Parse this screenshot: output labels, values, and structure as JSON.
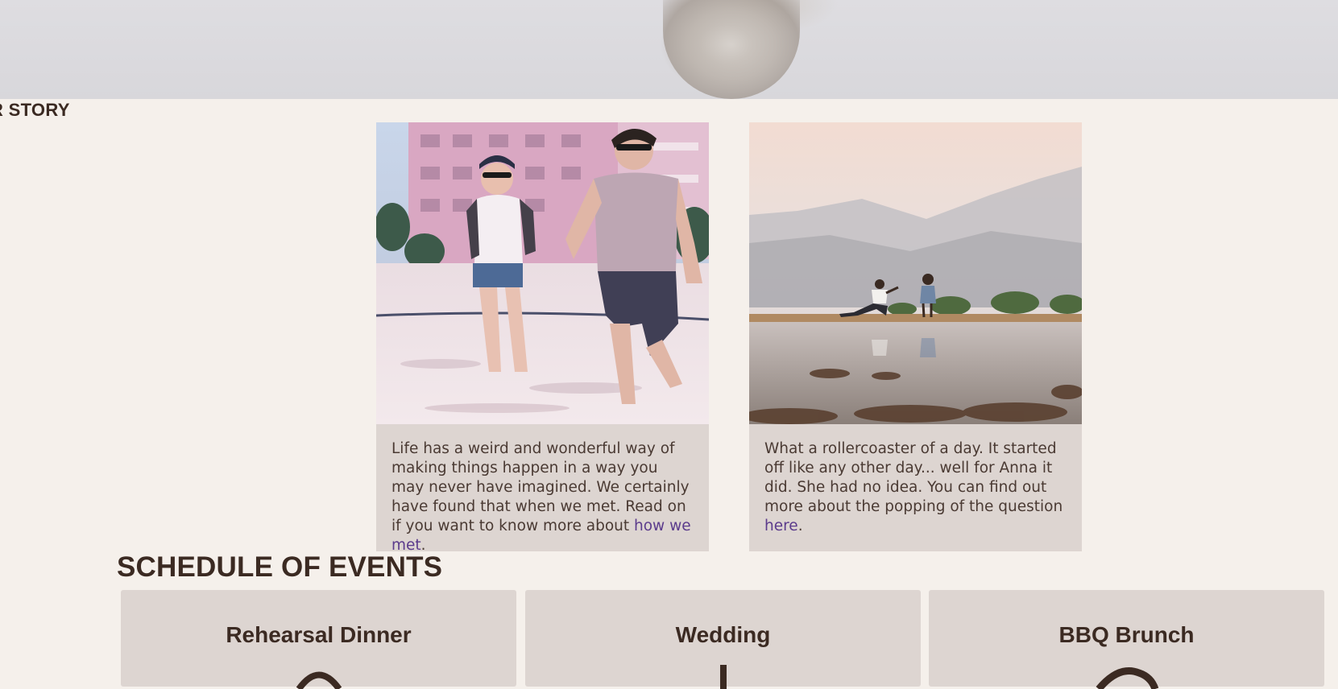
{
  "story": {
    "heading": "R STORY",
    "cards": [
      {
        "text": "Life has a weird and wonderful way of making things happen in a way you may never have imagined. We certainly have found that when we met. Read on if you want to know more about ",
        "link": "how we met",
        "suffix": "."
      },
      {
        "text": "What a rollercoaster of a day. It started off like any other day... well for Anna it did. She had no idea. You can find out more about the popping of the question ",
        "link": "here",
        "suffix": "."
      }
    ]
  },
  "schedule": {
    "heading": "SCHEDULE OF EVENTS",
    "events": [
      {
        "title": "Rehearsal Dinner",
        "icon": "dinner-icon"
      },
      {
        "title": "Wedding",
        "icon": "wedding-icon"
      },
      {
        "title": "BBQ Brunch",
        "icon": "brunch-icon"
      }
    ]
  },
  "colors": {
    "background": "#f5f0eb",
    "card": "#ddd5d1",
    "text": "#3b2a22",
    "link": "#5b3b8c"
  }
}
